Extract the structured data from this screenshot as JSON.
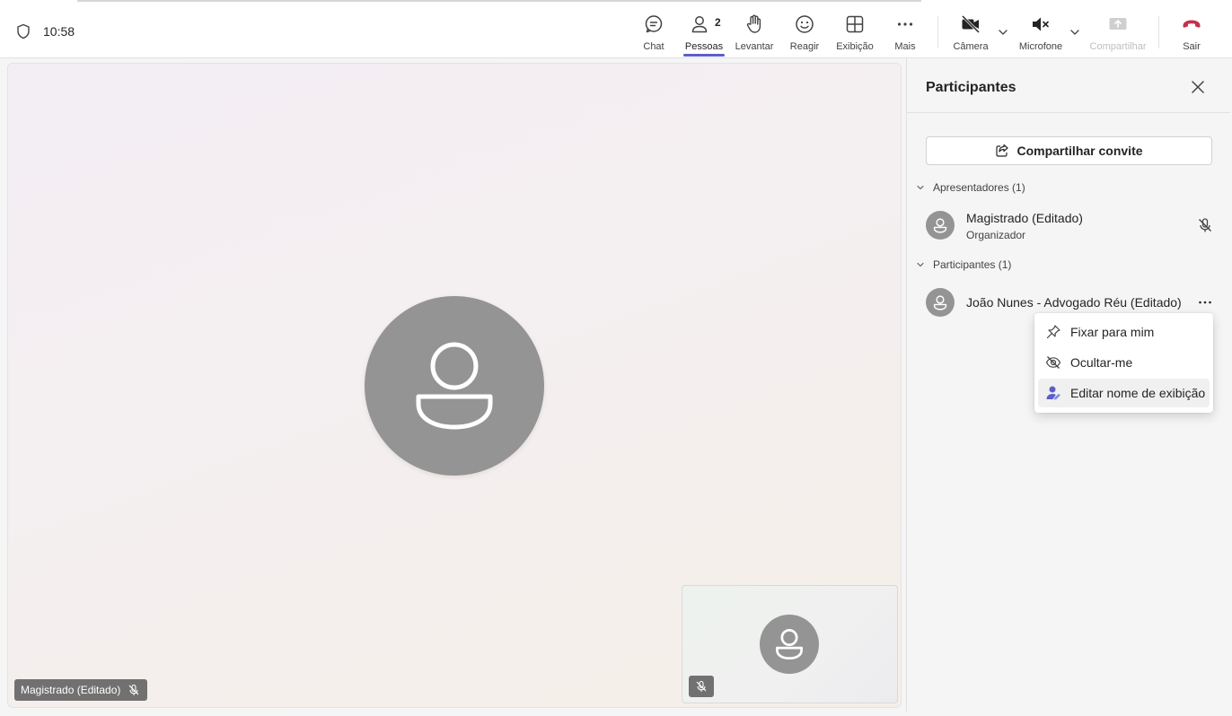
{
  "header": {
    "time": "10:58",
    "toolbar": {
      "chat": "Chat",
      "people": "Pessoas",
      "people_count": "2",
      "raise": "Levantar",
      "react": "Reagir",
      "view": "Exibição",
      "more": "Mais",
      "camera": "Câmera",
      "microphone": "Microfone",
      "share": "Compartilhar",
      "leave": "Sair"
    },
    "icons": [
      "shield-icon",
      "chat-icon",
      "people-icon",
      "hand-icon",
      "emoji-icon",
      "grid-icon",
      "more-icon",
      "camera-off-icon",
      "speaker-mute-icon",
      "share-tray-icon",
      "hangup-icon"
    ],
    "colors": {
      "accent": "#5b5fc7",
      "leave": "#c4314b"
    }
  },
  "stage": {
    "main_tag": "Magistrado (Editado)"
  },
  "panel": {
    "title": "Participantes",
    "share_invite": "Compartilhar convite",
    "sections": [
      {
        "header": "Apresentadores (1)",
        "people": [
          {
            "name": "Magistrado (Editado)",
            "role": "Organizador"
          }
        ]
      },
      {
        "header": "Participantes (1)",
        "people": [
          {
            "name": "João Nunes - Advogado Réu (Editado)"
          }
        ]
      }
    ]
  },
  "context_menu": {
    "items": [
      {
        "label": "Fixar para mim",
        "icon": "pin-icon"
      },
      {
        "label": "Ocultar-me",
        "icon": "eye-off-icon"
      },
      {
        "label": "Editar nome de exibição",
        "icon": "person-edit-icon"
      }
    ]
  }
}
